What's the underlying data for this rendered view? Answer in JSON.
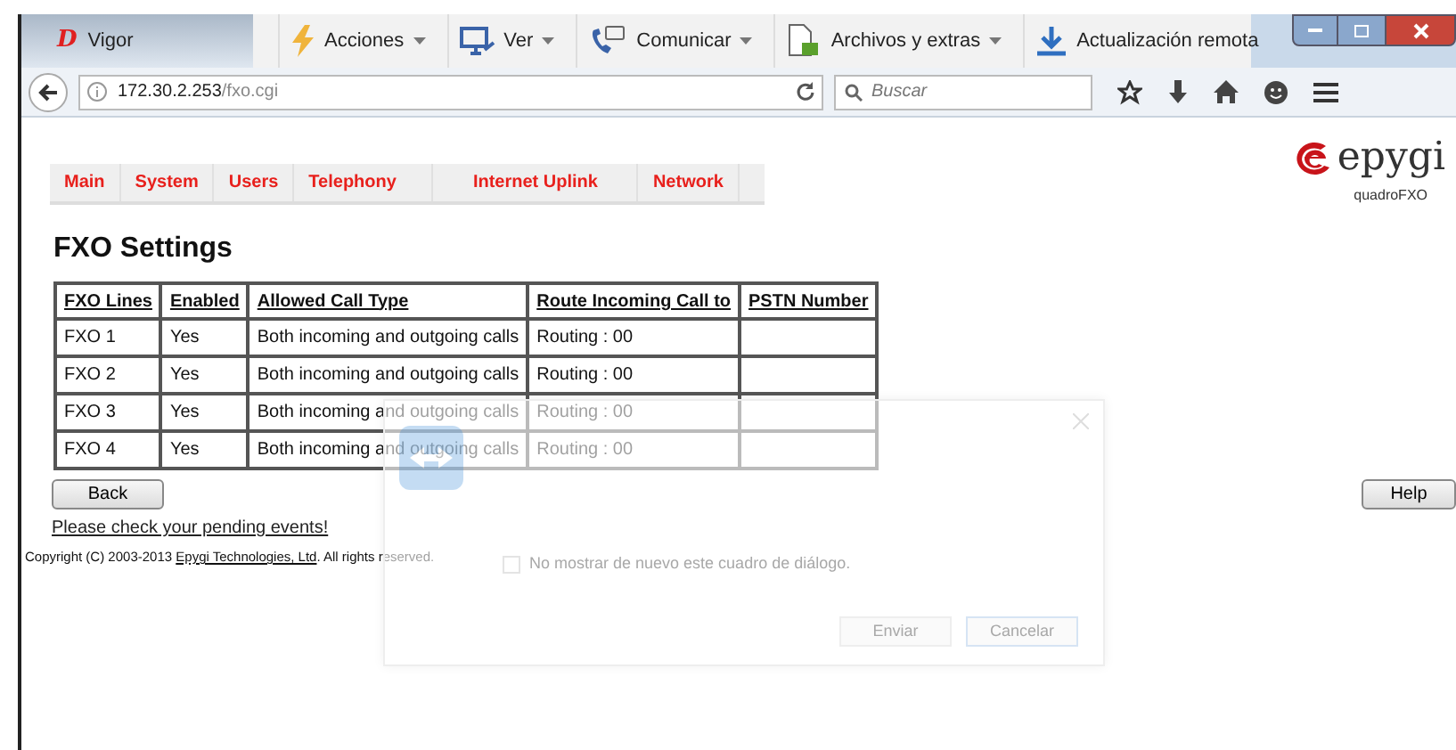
{
  "browser": {
    "tab": {
      "title": "Vigor",
      "icon": "D"
    },
    "toolbar": [
      {
        "label": "Acciones",
        "kind": "menu"
      },
      {
        "label": "Ver",
        "kind": "menu"
      },
      {
        "label": "Comunicar",
        "kind": "menu"
      },
      {
        "label": "Archivos y extras",
        "kind": "menu"
      },
      {
        "label": "Actualización remota",
        "kind": "plain"
      }
    ],
    "address": {
      "host": "172.30.2.253",
      "path": "/fxo.cgi"
    },
    "search": {
      "placeholder": "Buscar"
    }
  },
  "nav": [
    {
      "label": "Main"
    },
    {
      "label": "System"
    },
    {
      "label": "Users"
    },
    {
      "label": "Telephony"
    },
    {
      "label": "Internet Uplink"
    },
    {
      "label": "Network"
    }
  ],
  "logo": {
    "brand": "epygi",
    "product": "quadroFXO"
  },
  "title": "FXO Settings",
  "table": {
    "columns": [
      "FXO Lines",
      "Enabled",
      "Allowed Call Type",
      "Route Incoming Call to",
      "PSTN Number"
    ],
    "rows": [
      [
        "FXO 1",
        "Yes",
        "Both incoming and outgoing calls",
        "Routing : 00"
      ],
      [
        "FXO 2",
        "Yes",
        "Both incoming and outgoing calls",
        "Routing : 00"
      ],
      [
        "FXO 3",
        "Yes",
        "Both incoming and outgoing calls",
        "Routing : 00"
      ],
      [
        "FXO 4",
        "Yes",
        "Both incoming and outgoing calls",
        "Routing : 00"
      ]
    ]
  },
  "buttons": {
    "back": "Back",
    "help": "Help"
  },
  "events_link": "Please check your pending events!",
  "copyright": {
    "before": "Copyright (C) 2003-2013 ",
    "link": "Epygi Technologies, Ltd",
    "after": ". All rights reserved."
  },
  "dialog": {
    "checkbox": {
      "label": "No mostrar de nuevo este cuadro de diálogo.",
      "checked": false
    },
    "buttons": [
      "Enviar",
      "Cancelar"
    ]
  }
}
